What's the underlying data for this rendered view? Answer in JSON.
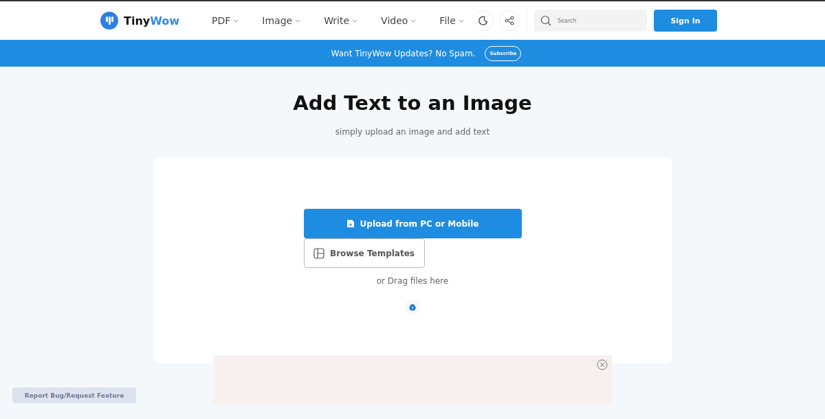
{
  "header": {
    "logo": {
      "first": "Tiny",
      "second": "Wow"
    },
    "nav": [
      {
        "label": "PDF"
      },
      {
        "label": "Image"
      },
      {
        "label": "Write"
      },
      {
        "label": "Video"
      },
      {
        "label": "File"
      }
    ],
    "search": {
      "placeholder": "Search"
    },
    "sign_in": "Sign In"
  },
  "banner": {
    "text": "Want TinyWow Updates? No Spam.",
    "button": "Subscribe"
  },
  "title": "Add Text to an Image",
  "subtitle": "simply upload an image and add text",
  "upload": {
    "primary": "Upload from PC or Mobile",
    "secondary": "Browse Templates",
    "hint": "or Drag files here"
  },
  "report_button": "Report Bug/Request Feature"
}
